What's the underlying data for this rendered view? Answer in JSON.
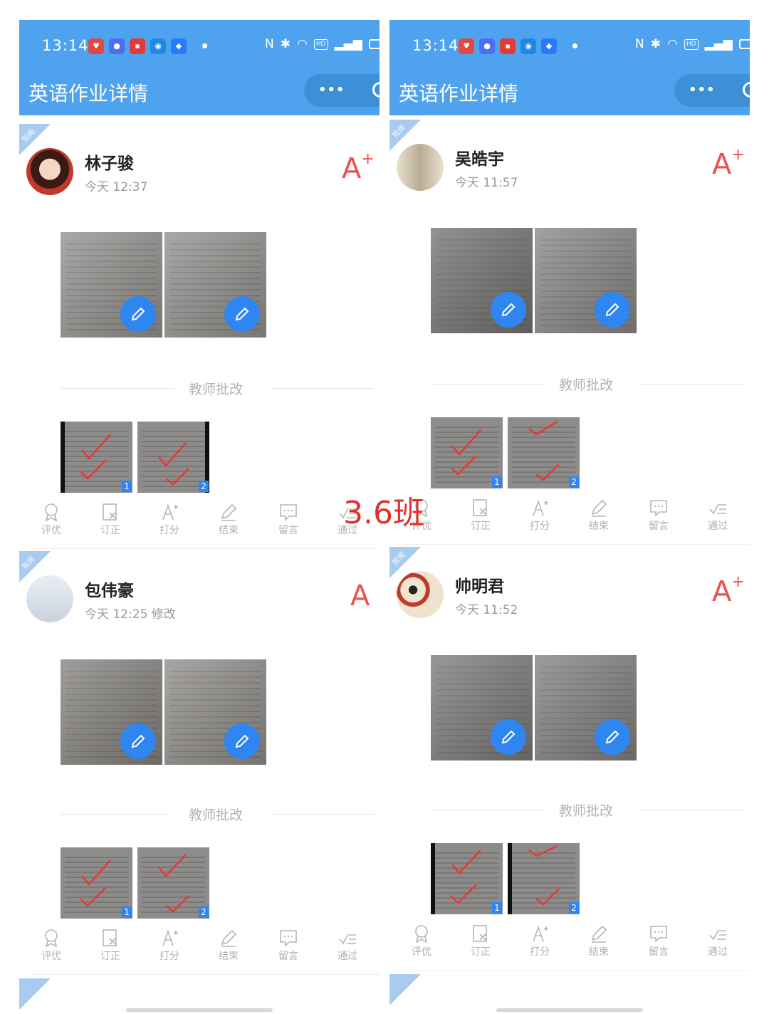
{
  "overlay_label": "3.6班",
  "panels": [
    {
      "status": {
        "time": "13:14"
      },
      "page_title": "英语作业详情",
      "capsule_more": "•••",
      "cards": [
        {
          "ribbon": "批阅",
          "name": "林子骏",
          "time": "今天 12:37",
          "grade": "A",
          "grade_sup": "+",
          "section_label": "教师批改",
          "corr_nums": [
            "1",
            "2"
          ]
        },
        {
          "ribbon": "批阅",
          "name": "包伟豪",
          "time": "今天 12:25 修改",
          "grade": "A",
          "grade_sup": "",
          "section_label": "教师批改",
          "corr_nums": [
            "1",
            "2"
          ]
        }
      ]
    },
    {
      "status": {
        "time": "13:14"
      },
      "page_title": "英语作业详情",
      "capsule_more": "•••",
      "cards": [
        {
          "ribbon": "批阅",
          "name": "吴皓宇",
          "time": "今天 11:57",
          "grade": "A",
          "grade_sup": "+",
          "section_label": "教师批改",
          "corr_nums": [
            "1",
            "2"
          ]
        },
        {
          "ribbon": "批阅",
          "name": "帅明君",
          "time": "今天 11:52",
          "grade": "A",
          "grade_sup": "+",
          "section_label": "教师批改",
          "corr_nums": [
            "1",
            "2"
          ]
        }
      ]
    }
  ],
  "toolbar": {
    "items": [
      "评优",
      "订正",
      "打分",
      "结束",
      "留言",
      "通过"
    ]
  },
  "colors": {
    "header": "#4fa3ee",
    "accent": "#2f86f0",
    "grade": "#e9534f",
    "overlay": "#e0302b"
  },
  "icons": [
    "medal-icon",
    "correct-icon",
    "score-icon",
    "end-pen-icon",
    "comment-icon",
    "pass-icon",
    "pencil-icon"
  ]
}
